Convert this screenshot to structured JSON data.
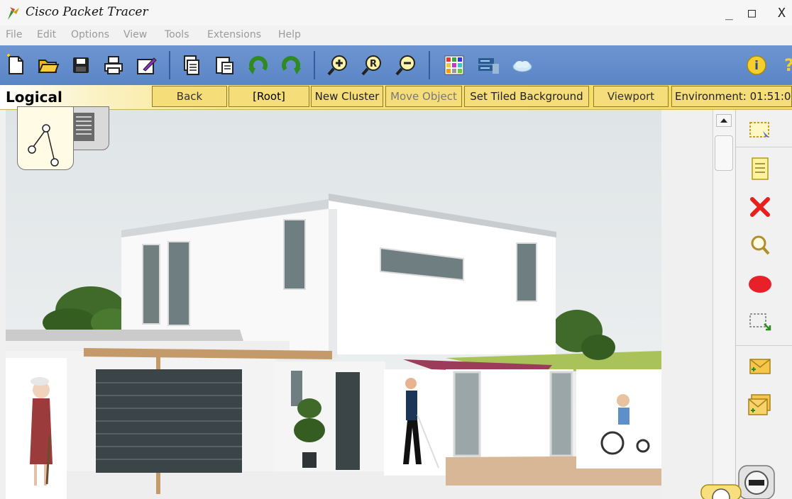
{
  "window": {
    "title": "Cisco Packet Tracer",
    "controls": {
      "minimize": "_",
      "maximize": "□",
      "close": "X"
    }
  },
  "menubar": {
    "items": [
      "File",
      "Edit",
      "Options",
      "View",
      "Tools",
      "Extensions",
      "Help"
    ]
  },
  "toolbar": {
    "icons": [
      "new-file-icon",
      "open-folder-icon",
      "save-icon",
      "print-icon",
      "activity-wizard-icon",
      "copy-icon",
      "paste-icon",
      "undo-icon",
      "redo-icon",
      "zoom-in-icon",
      "zoom-reset-icon",
      "zoom-out-icon",
      "palette-icon",
      "device-template-icon",
      "cloud-icon",
      "info-icon",
      "help-icon"
    ],
    "help_glyph": "?",
    "info_glyph": "i",
    "zoom_reset_glyph": "R"
  },
  "logical_bar": {
    "mode_label": "Logical",
    "back_label": "Back",
    "root_label": "[Root]",
    "new_cluster_label": "New Cluster",
    "move_object_label": "Move Object",
    "set_tiled_background_label": "Set Tiled Background",
    "viewport_label": "Viewport",
    "environment_label": "Environment: 01:51:0"
  },
  "palette": {
    "tools": [
      "select-icon",
      "note-icon",
      "delete-icon",
      "inspect-icon",
      "draw-ellipse-icon",
      "resize-icon",
      "add-simple-pdu-icon",
      "add-complex-pdu-icon"
    ]
  },
  "colors": {
    "toolbar_blue": "#5f89c9",
    "logical_yellow": "#f5d85c",
    "delete_red": "#e8201c",
    "ellipse_red": "#e8202a"
  }
}
